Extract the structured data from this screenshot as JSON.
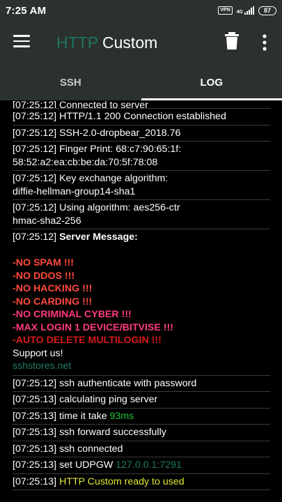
{
  "status_bar": {
    "time": "7:25 AM",
    "vpn_label": "VPN",
    "network_label": "4G",
    "battery": "87"
  },
  "app_bar": {
    "title_part1": "HTTP",
    "title_part2": "Custom",
    "menu_icon": "hamburger-icon",
    "delete_icon": "trash-icon",
    "more_icon": "more-vert-icon"
  },
  "tabs": [
    {
      "label": "SSH",
      "active": false
    },
    {
      "label": "LOG",
      "active": true
    }
  ],
  "log": {
    "partial_top": "[07:25:12] Connected to server",
    "entries_top": [
      {
        "time": "[07:25:12]",
        "text": "HTTP/1.1 200 Connection established"
      },
      {
        "time": "[07:25:12]",
        "text": "SSH-2.0-dropbear_2018.76"
      },
      {
        "time": "[07:25:12]",
        "text": "Finger Print: 68:c7:90:65:1f:",
        "line2": "58:52:a2:ea:cb:be:da:70:5f:78:08"
      },
      {
        "time": "[07:25:12]",
        "text": "Key exchange algorithm:",
        "line2": "diffie-hellman-group14-sha1"
      },
      {
        "time": "[07:25:12]",
        "text": "Using algorithm: aes256-ctr",
        "line2": "hmac-sha2-256"
      }
    ],
    "server_message": {
      "time": "[07:25:12]",
      "label": "Server Message:",
      "rules": [
        {
          "text": "-NO SPAM !!!",
          "style": "a"
        },
        {
          "text": "-NO DDOS !!!",
          "style": "a"
        },
        {
          "text": "-NO HACKING !!!",
          "style": "a"
        },
        {
          "text": "-NO CARDING !!!",
          "style": "a"
        },
        {
          "text": "-NO CRIMINAL CYBER !!!",
          "style": "b"
        },
        {
          "text": "-MAX LOGIN 1 DEVICE/BITVISE !!!",
          "style": "b"
        },
        {
          "text": "-AUTO DELETE MULTILOGIN !!!",
          "style": "c"
        }
      ],
      "support": "Support us!",
      "site": "sshstores.net"
    },
    "entries_bottom": [
      {
        "time": "[07:25:12]",
        "text": "ssh authenticate with password"
      },
      {
        "time": "[07:25:13]",
        "text": "calculating ping server"
      },
      {
        "time": "[07:25:13]",
        "text": "time it take ",
        "highlight": "93ms",
        "hl": "green"
      },
      {
        "time": "[07:25:13]",
        "text": "ssh forward successfully"
      },
      {
        "time": "[07:25:13]",
        "text": "ssh connected"
      },
      {
        "time": "[07:25:13]",
        "text": "set UDPGW ",
        "highlight": "127.0.0.1:7291",
        "hl": "teal"
      },
      {
        "time": "[07:25:13]",
        "text": "",
        "highlight": "HTTP Custom ready to used",
        "hl": "yellow"
      }
    ]
  },
  "colors": {
    "toolbar_bg": "#2b312d",
    "accent_teal": "#1d7563",
    "log_bg": "#000000",
    "green": "#21c43a",
    "yellow": "#e3ea2f",
    "red": "#ff4a3d",
    "pink": "#ff3a7e"
  }
}
